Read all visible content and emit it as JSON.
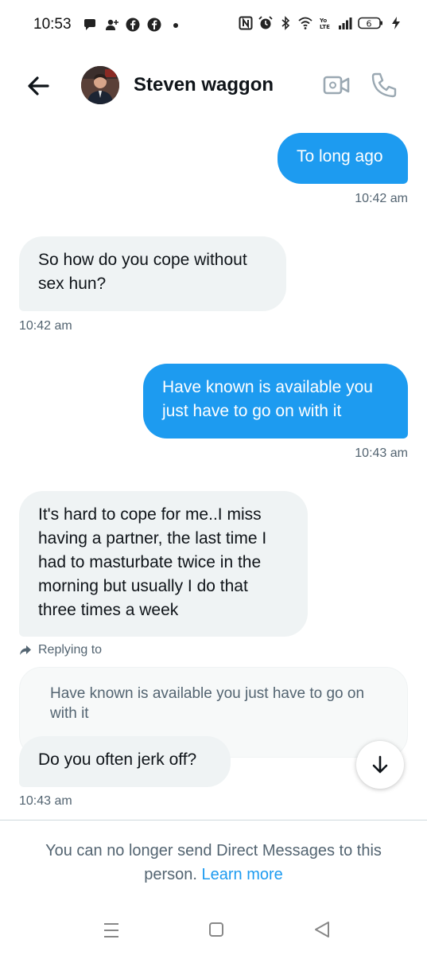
{
  "status_bar": {
    "time": "10:53",
    "battery_level": "6",
    "left_icons": [
      "chat-bubble-icon",
      "person-add-icon",
      "facebook-icon",
      "facebook-icon",
      "dot-icon"
    ],
    "right_icons": [
      "nfc-icon",
      "alarm-icon",
      "bluetooth-icon",
      "wifi-icon",
      "volte-icon",
      "signal-icon",
      "battery-icon",
      "charging-icon"
    ]
  },
  "header": {
    "contact_name": "Steven waggon",
    "back_icon": "arrow-left-icon",
    "video_icon": "video-call-icon",
    "call_icon": "phone-icon"
  },
  "messages": [
    {
      "direction": "sent",
      "text": "To long ago",
      "time": "10:42 am"
    },
    {
      "direction": "received",
      "text": "So how do you cope without sex hun?",
      "time": "10:42 am"
    },
    {
      "direction": "sent",
      "text": "Have known is available you just have to go on with it",
      "time": "10:43 am"
    },
    {
      "direction": "received",
      "text": "It's hard to cope for me..I miss having a partner, the last time I had to masturbate twice in the morning but usually I do that three times a week"
    },
    {
      "direction": "received",
      "replying_label": "Replying to",
      "quoted_text": "Have known is available you just have to go on with it",
      "text": "Do you often jerk off?",
      "time": "10:43 am"
    }
  ],
  "footer": {
    "notice": "You can no longer send Direct Messages to this person.",
    "learn_more": "Learn more"
  },
  "colors": {
    "accent": "#1d9bf0",
    "received_bubble": "#eff3f4",
    "secondary_text": "#536471"
  }
}
